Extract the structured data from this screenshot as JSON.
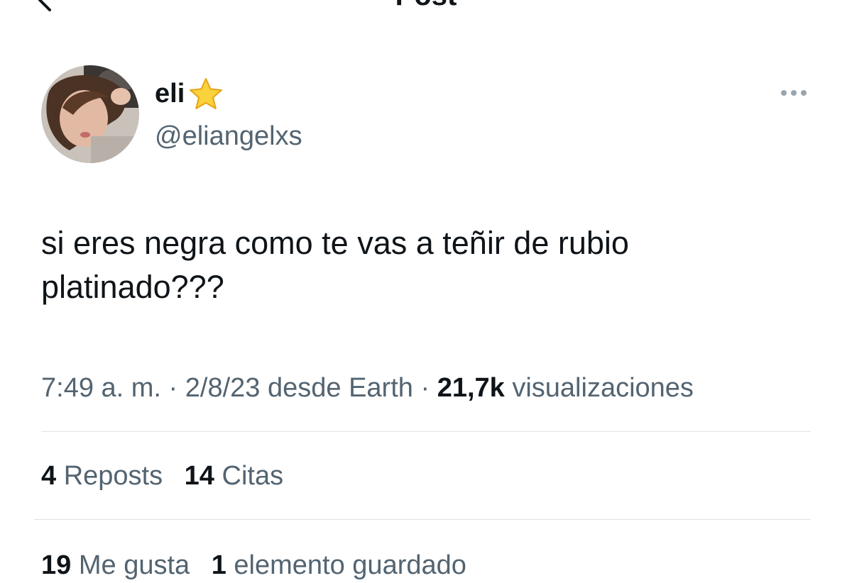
{
  "header": {
    "title": "Post"
  },
  "author": {
    "display_name": "eli",
    "handle": "@eliangelxs"
  },
  "post": {
    "text": "si eres negra como te vas a teñir de rubio platinado???",
    "time": "7:49 a. m.",
    "separator": "·",
    "date_source": "2/8/23 desde Earth",
    "views_count": "21,7k",
    "views_label": "visualizaciones"
  },
  "stats": {
    "reposts_count": "4",
    "reposts_label": "Reposts",
    "quotes_count": "14",
    "quotes_label": "Citas",
    "likes_count": "19",
    "likes_label": "Me gusta",
    "bookmarks_count": "1",
    "bookmarks_label": "elemento guardado"
  },
  "icons": {
    "back": "chevron-left-icon",
    "badge": "star-icon",
    "more": "more-horizontal-icon"
  },
  "colors": {
    "text_primary": "#0f1419",
    "text_secondary": "#536471",
    "divider": "#dfe3e6",
    "star": "#f7c531"
  }
}
